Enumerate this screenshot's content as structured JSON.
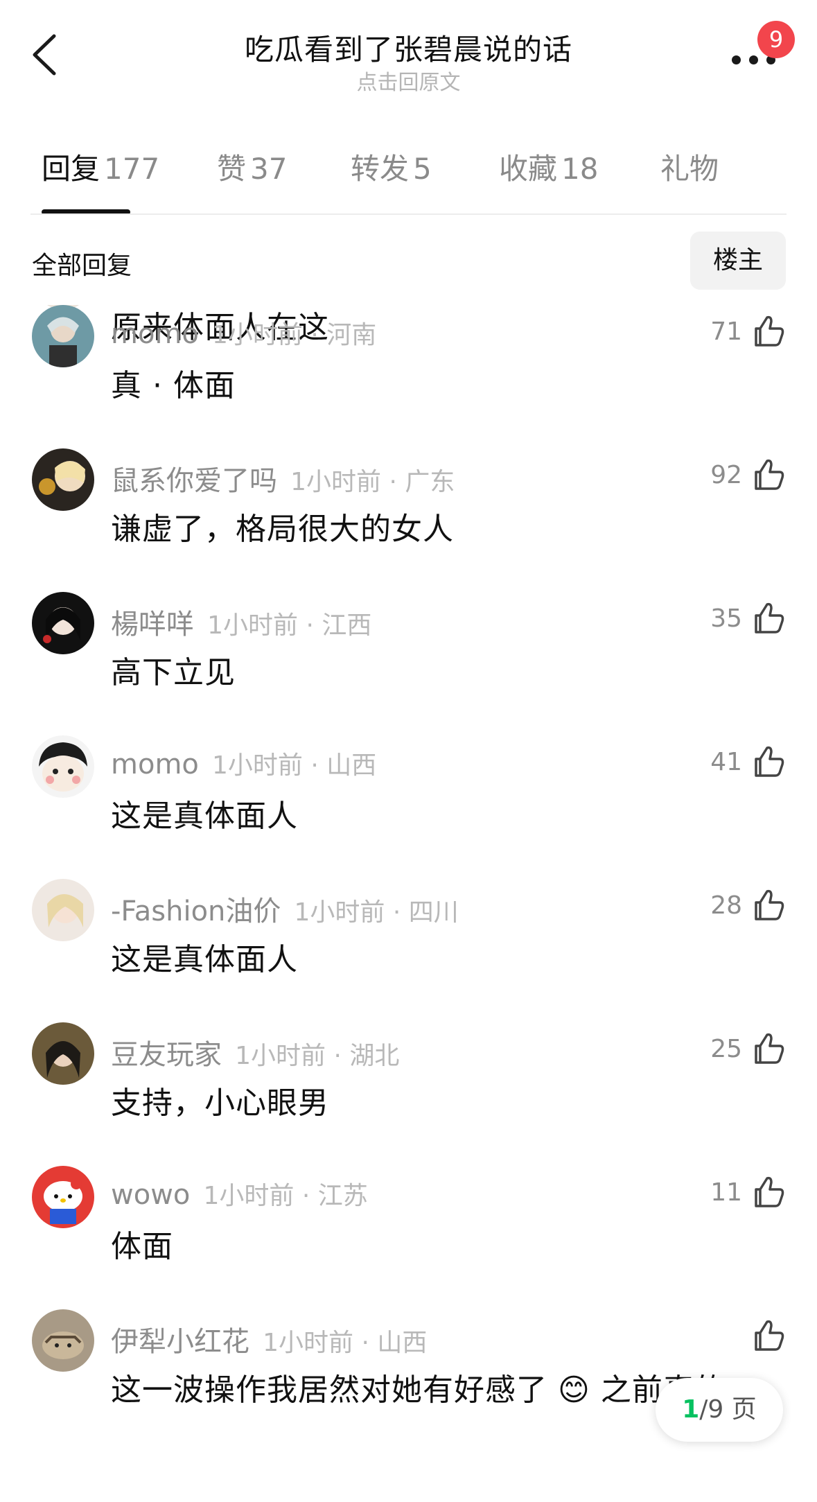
{
  "header": {
    "title": "吃瓜看到了张碧晨说的话",
    "subtitle": "点击回原文",
    "badge": "9"
  },
  "tabs": [
    {
      "label": "回复",
      "count": "177"
    },
    {
      "label": "赞",
      "count": "37"
    },
    {
      "label": "转发",
      "count": "5"
    },
    {
      "label": "收藏",
      "count": "18"
    },
    {
      "label": "礼物",
      "count": ""
    }
  ],
  "filter": {
    "label": "全部回复",
    "op_button": "楼主"
  },
  "comments": [
    {
      "username": "",
      "time_loc": "",
      "content": "原来体面人在这",
      "likes": ""
    },
    {
      "username": "momo",
      "time_loc": "1小时前 · 河南",
      "content": "真 · 体面",
      "likes": "71"
    },
    {
      "username": "鼠系你爱了吗",
      "time_loc": "1小时前 · 广东",
      "content": "谦虚了，格局很大的女人",
      "likes": "92"
    },
    {
      "username": "楊咩咩",
      "time_loc": "1小时前 · 江西",
      "content": "高下立见",
      "likes": "35"
    },
    {
      "username": "momo",
      "time_loc": "1小时前 · 山西",
      "content": "这是真体面人",
      "likes": "41"
    },
    {
      "username": "-Fashion油价",
      "time_loc": "1小时前 · 四川",
      "content": "这是真体面人",
      "likes": "28"
    },
    {
      "username": "豆友玩家",
      "time_loc": "1小时前 · 湖北",
      "content": "支持，小心眼男",
      "likes": "25"
    },
    {
      "username": "wowo",
      "time_loc": "1小时前 · 江苏",
      "content": "体面",
      "likes": "11"
    },
    {
      "username": "伊犁小红花",
      "time_loc": "1小时前 · 山西",
      "content": "这一波操作我居然对她有好感了 😊 之前真的",
      "likes": ""
    }
  ],
  "pager": {
    "current": "1",
    "total": "/9 页"
  },
  "colors": {
    "badge": "#f2454c",
    "pager_current": "#07c160",
    "secondary_text": "#8c8c8c"
  }
}
